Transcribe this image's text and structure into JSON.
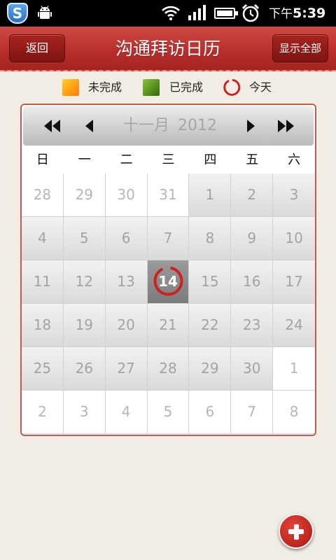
{
  "status_bar": {
    "shield_letter": "S",
    "time_prefix": "下午",
    "time": "5:39",
    "icons": [
      "shield-icon",
      "android-icon",
      "wifi-icon",
      "signal-icon",
      "battery-icon",
      "alarm-icon"
    ]
  },
  "title_bar": {
    "back_label": "返回",
    "title": "沟通拜访日历",
    "show_all_label": "显示全部"
  },
  "legend": {
    "undone_label": "未完成",
    "done_label": "已完成",
    "today_label": "今天",
    "colors": {
      "undone": "#ff9a10",
      "done": "#5a9420",
      "today": "#d0201e"
    }
  },
  "calendar": {
    "month": "十一月",
    "year": "2012",
    "nav_icons": [
      "prev-year-icon",
      "prev-month-icon",
      "next-month-icon",
      "next-year-icon"
    ],
    "weekdays": [
      "日",
      "一",
      "二",
      "三",
      "四",
      "五",
      "六"
    ],
    "today": "14",
    "weeks": [
      [
        "28",
        "29",
        "30",
        "31",
        "1",
        "2",
        "3"
      ],
      [
        "4",
        "5",
        "6",
        "7",
        "8",
        "9",
        "10"
      ],
      [
        "11",
        "12",
        "13",
        "14",
        "15",
        "16",
        "17"
      ],
      [
        "18",
        "19",
        "20",
        "21",
        "22",
        "23",
        "24"
      ],
      [
        "25",
        "26",
        "27",
        "28",
        "29",
        "30",
        "1"
      ],
      [
        "2",
        "3",
        "4",
        "5",
        "6",
        "7",
        "8"
      ]
    ],
    "other_month_cells": [
      [
        0,
        0
      ],
      [
        0,
        1
      ],
      [
        0,
        2
      ],
      [
        0,
        3
      ],
      [
        4,
        6
      ],
      [
        5,
        0
      ],
      [
        5,
        1
      ],
      [
        5,
        2
      ],
      [
        5,
        3
      ],
      [
        5,
        4
      ],
      [
        5,
        5
      ],
      [
        5,
        6
      ]
    ],
    "accent_color": "#c75955"
  },
  "fab": {
    "icon": "plus-icon"
  }
}
